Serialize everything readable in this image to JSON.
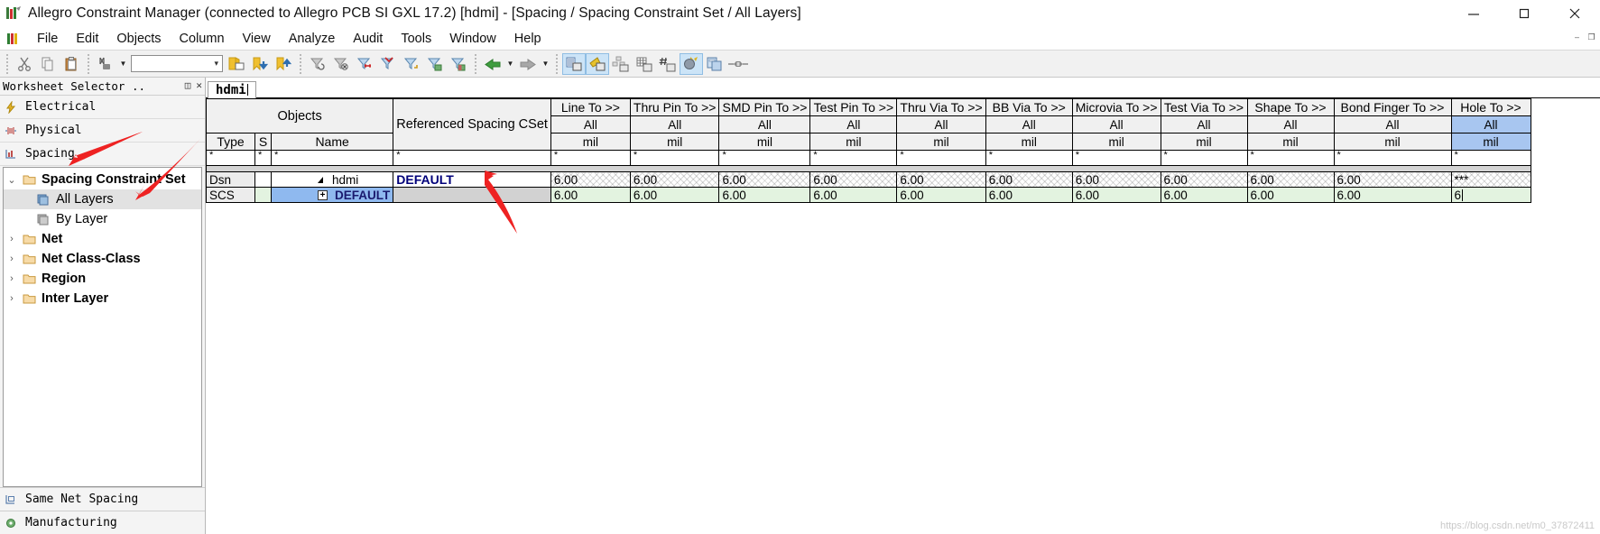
{
  "window": {
    "title": "Allegro Constraint Manager (connected to Allegro PCB SI GXL 17.2) [hdmi] - [Spacing / Spacing Constraint Set / All Layers]",
    "app_icon": "allegro-icon",
    "minimize": "—",
    "maximize": "□",
    "close": "✕",
    "mdi_restore": "–",
    "mdi_maximize": "❐"
  },
  "menu": {
    "icon": "allegro-menu-icon",
    "items": [
      "File",
      "Edit",
      "Objects",
      "Column",
      "View",
      "Analyze",
      "Audit",
      "Tools",
      "Window",
      "Help"
    ]
  },
  "toolbar": {
    "combo_value": "",
    "groups": [
      {
        "buttons": [
          "cut-icon",
          "copy-icon",
          "paste-icon"
        ]
      },
      {
        "buttons": [
          "find-icon",
          "find-dropdown-caret",
          "find-combo",
          "bookmark-view-icon",
          "bookmark-next-icon",
          "bookmark-prev-icon"
        ]
      },
      {
        "buttons": [
          "filter-refresh-icon",
          "filter-clear-icon",
          "filter-delete-icon",
          "filter-apply-icon",
          "filter-sort-icon",
          "filter-show-icon",
          "filter-hide-icon"
        ]
      },
      {
        "buttons": [
          "back-arrow-icon",
          "back-dropdown-caret",
          "forward-arrow-icon",
          "forward-dropdown-caret"
        ]
      },
      {
        "buttons": [
          "worksheet-icon",
          "electrical-icon",
          "hierarchy-icon",
          "grid-icon",
          "hash-icon",
          "analyze-icon",
          "report-icon",
          "measure-icon"
        ]
      }
    ]
  },
  "worksheet_selector": {
    "title": "Worksheet Selector ..",
    "float_icon": "float-icon",
    "close_icon": "close-icon",
    "categories": [
      {
        "label": "Electrical",
        "icon": "electrical-bolt-icon"
      },
      {
        "label": "Physical",
        "icon": "physical-icon"
      },
      {
        "label": "Spacing",
        "icon": "spacing-icon"
      }
    ],
    "tree": [
      {
        "label": "Spacing Constraint Set",
        "twisty": "⌄",
        "icon": "folder-icon",
        "depth": 0,
        "bold": true,
        "selected": false
      },
      {
        "label": "All Layers",
        "twisty": "",
        "icon": "layers-icon",
        "depth": 1,
        "bold": false,
        "selected": true
      },
      {
        "label": "By Layer",
        "twisty": "",
        "icon": "layers-icon",
        "depth": 1,
        "bold": false,
        "selected": false
      },
      {
        "label": "Net",
        "twisty": "›",
        "icon": "folder-icon",
        "depth": 0,
        "bold": true,
        "selected": false
      },
      {
        "label": "Net Class-Class",
        "twisty": "›",
        "icon": "folder-icon",
        "depth": 0,
        "bold": true,
        "selected": false
      },
      {
        "label": "Region",
        "twisty": "›",
        "icon": "folder-icon",
        "depth": 0,
        "bold": true,
        "selected": false
      },
      {
        "label": "Inter Layer",
        "twisty": "›",
        "icon": "folder-icon",
        "depth": 0,
        "bold": true,
        "selected": false
      }
    ],
    "footers": [
      {
        "label": "Same Net Spacing",
        "icon": "same-net-spacing-icon"
      },
      {
        "label": "Manufacturing",
        "icon": "manufacturing-icon"
      }
    ]
  },
  "tabs": [
    {
      "label": "hdmi",
      "active": true
    }
  ],
  "grid": {
    "group_headers": [
      {
        "label": "Objects",
        "span": 3
      },
      {
        "label": "Referenced Spacing CSet",
        "span": 1
      }
    ],
    "object_columns": [
      "Type",
      "S",
      "Name"
    ],
    "measure_columns": [
      "Line To >>",
      "Thru Pin To >>",
      "SMD Pin To >>",
      "Test Pin To >>",
      "Thru Via To >>",
      "BB Via To >>",
      "Microvia To >>",
      "Test Via To >>",
      "Shape To >>",
      "Bond Finger To >>",
      "Hole To >>"
    ],
    "layer_row": "All",
    "unit_row": "mil",
    "highlighted_column_index": 10,
    "filter_marker": "*",
    "rows": [
      {
        "type": "Dsn",
        "s": "",
        "name": "hdmi",
        "name_glyph": "triangle",
        "referenced_cset": "DEFAULT",
        "values": [
          "6.00",
          "6.00",
          "6.00",
          "6.00",
          "6.00",
          "6.00",
          "6.00",
          "6.00",
          "6.00",
          "6.00",
          "***"
        ]
      },
      {
        "type": "SCS",
        "s": "",
        "name": "DEFAULT",
        "name_glyph": "expander",
        "expander_symbol": "+",
        "referenced_cset": "",
        "values": [
          "6.00",
          "6.00",
          "6.00",
          "6.00",
          "6.00",
          "6.00",
          "6.00",
          "6.00",
          "6.00",
          "6.00",
          "6"
        ],
        "editing_last_cell": true
      }
    ]
  },
  "annotations": {
    "arrow_color": "#ee2222",
    "arrows": [
      {
        "name": "arrow-to-spacing"
      },
      {
        "name": "arrow-to-all-layers"
      },
      {
        "name": "arrow-to-line-to-cell"
      }
    ]
  },
  "watermark": "https://blog.csdn.net/m0_37872411"
}
